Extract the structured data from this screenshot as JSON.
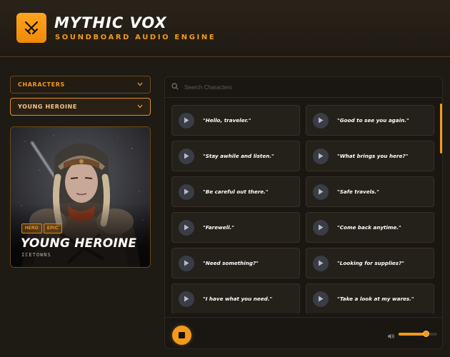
{
  "app": {
    "title": "MYTHIC VOX",
    "subtitle": "SOUNDBOARD AUDIO ENGINE",
    "logo_icon": "crossed-swords-icon"
  },
  "sidebar": {
    "category_select": "CHARACTERS",
    "character_select": "YOUNG HEROINE",
    "chevron_icon": "chevron-down-icon"
  },
  "character": {
    "name": "YOUNG HEROINE",
    "origin": "ICETOWNS",
    "badges": [
      "HERO",
      "EPIC"
    ]
  },
  "search": {
    "placeholder": "Search Characters",
    "value": ""
  },
  "clips": [
    "\"Hello, traveler.\"",
    "\"Good to see you again.\"",
    "\"Stay awhile and listen.\"",
    "\"What brings you here?\"",
    "\"Be careful out there.\"",
    "\"Safe travels.\"",
    "\"Farewell.\"",
    "\"Come back anytime.\"",
    "\"Need something?\"",
    "\"Looking for supplies?\"",
    "\"I have what you need.\"",
    "\"Take a look at my wares.\""
  ],
  "player": {
    "stop_icon": "stop-icon",
    "volume_icon": "volume-icon",
    "volume_level": 0.72
  },
  "colors": {
    "accent": "#f39a1a",
    "background": "#1e1a14"
  }
}
